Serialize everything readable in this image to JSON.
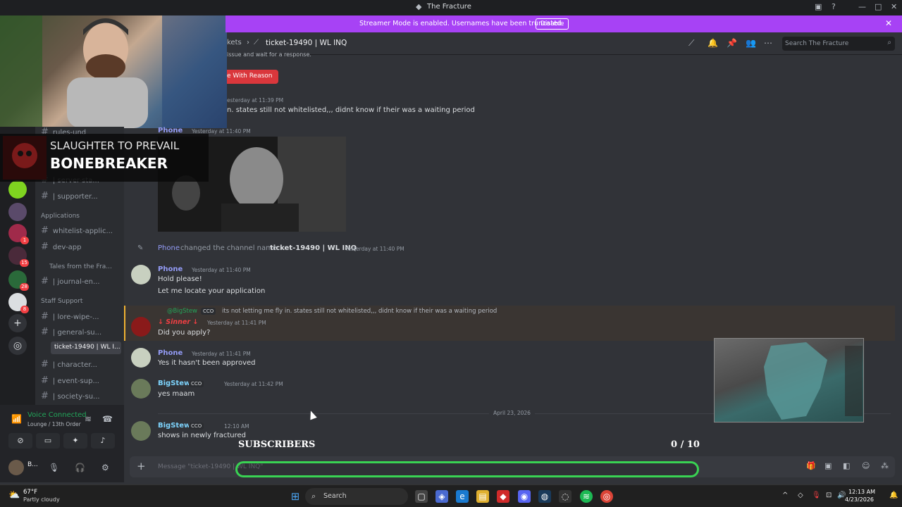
{
  "window": {
    "title": "The Fracture",
    "banner": "Streamer Mode is enabled. Usernames have been truncated.",
    "banner_button": "Disable"
  },
  "header": {
    "crumb": "kets",
    "channel": "ticket-19490 | WL INQ",
    "search_placeholder": "Search The Fracture"
  },
  "overlay": {
    "line1": "SLAUGHTER TO PREVAIL",
    "line2": "BONEBREAKER",
    "subs_label": "SUBSCRIBERS",
    "subs_count": "0 / 10"
  },
  "channels": {
    "items": [
      {
        "name": "rules-und"
      },
      {
        "name": "| server-sta..."
      },
      {
        "name": "| supporter..."
      },
      {
        "name": "whitelist-applic..."
      },
      {
        "name": "dev-app"
      },
      {
        "name": "| journal-en..."
      },
      {
        "name": "| lore-wipe-..."
      },
      {
        "name": "| general-su..."
      },
      {
        "name": "| character..."
      },
      {
        "name": "| event-sup..."
      },
      {
        "name": "| society-su..."
      }
    ],
    "categories": {
      "applications": "Applications",
      "tales": "Tales from the Fra...",
      "staff": "Staff Support"
    },
    "active": "ticket-19490 | WL I..."
  },
  "servers": {
    "badges": [
      "1",
      "15",
      "28",
      "8"
    ]
  },
  "user_panel": {
    "voice_title": "Voice Connected",
    "voice_sub": "Lounge / 13th Order",
    "username": "B..."
  },
  "messages": {
    "top_partial": "issue and wait for a response.",
    "close_reason": "e With Reason",
    "m1_ts": "esterday at 11:39 PM",
    "m1_text": "n. states still not whitelisted,,, didnt know if their was a waiting period",
    "m2_user": "Phone",
    "m2_ts": "Yesterday at 11:40 PM",
    "sys_user": "Phone",
    "sys_text": "changed the channel name:",
    "sys_channel": "ticket-19490 | WL INQ",
    "sys_ts": "Yesterday at 11:40 PM",
    "m3_user": "Phone",
    "m3_ts": "Yesterday at 11:40 PM",
    "m3_line1": "Hold please!",
    "m3_line2": "Let me locate your application",
    "reply_user": "@BigStew",
    "reply_tag": "CCO",
    "reply_text": "its not letting me fly in. states still not whitelisted,,, didnt know if their was a waiting period",
    "m4_user": "↓ Sinner ↓",
    "m4_ts": "Yesterday at 11:41 PM",
    "m4_text": "Did you apply?",
    "m5_user": "Phone",
    "m5_ts": "Yesterday at 11:41 PM",
    "m5_text": "Yes it hasn't been approved",
    "m6_user": "BigStew",
    "m6_tag": "CCO",
    "m6_ts": "Yesterday at 11:42 PM",
    "m6_text": "yes maam",
    "date_divider": "April 23, 2026",
    "m7_user": "BigStew",
    "m7_tag": "CCO",
    "m7_ts": "12:10 AM",
    "m7_text": "shows in newly fractured"
  },
  "composer": {
    "placeholder": "Message \"ticket-19490 | WL INQ\""
  },
  "taskbar": {
    "temp": "67°F",
    "weather": "Partly cloudy",
    "search": "Search",
    "time": "12:13 AM",
    "date": "4/23/2026"
  },
  "colors": {
    "accent": "#a742f5",
    "phone_name": "#949cf7",
    "bigstew_name": "#7dd3fc",
    "sinner_name": "#f23f43",
    "subs_bar": "#39d353"
  }
}
